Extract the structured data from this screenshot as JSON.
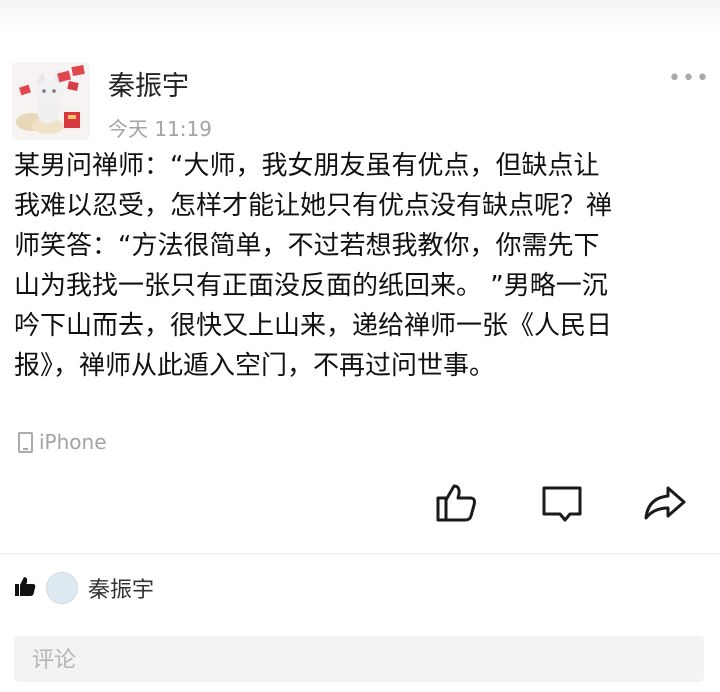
{
  "post": {
    "author": "秦振宇",
    "time": "今天 11:19",
    "content_lines": [
      "某男问禅师：“大师，我女朋友虽有优点，但缺点让",
      "我难以忍受，怎样才能让她只有优点没有缺点呢？禅",
      "师笑答：“方法很简单，不过若想我教你，你需先下",
      "山为我找一张只有正面没反面的纸回来。 ”男略一沉",
      "吟下山而去，很快又上山来，递给禅师一张《人民日",
      "报》，禅师从此遁入空门，不再过问世事。"
    ],
    "device": "iPhone"
  },
  "icons": {
    "more": "more-dots-icon",
    "like": "thumbs-up-icon",
    "comment": "comment-icon",
    "share": "share-icon",
    "device": "phone-icon"
  },
  "likes": {
    "liker": "秦振宇"
  },
  "comment": {
    "placeholder": "评论"
  }
}
